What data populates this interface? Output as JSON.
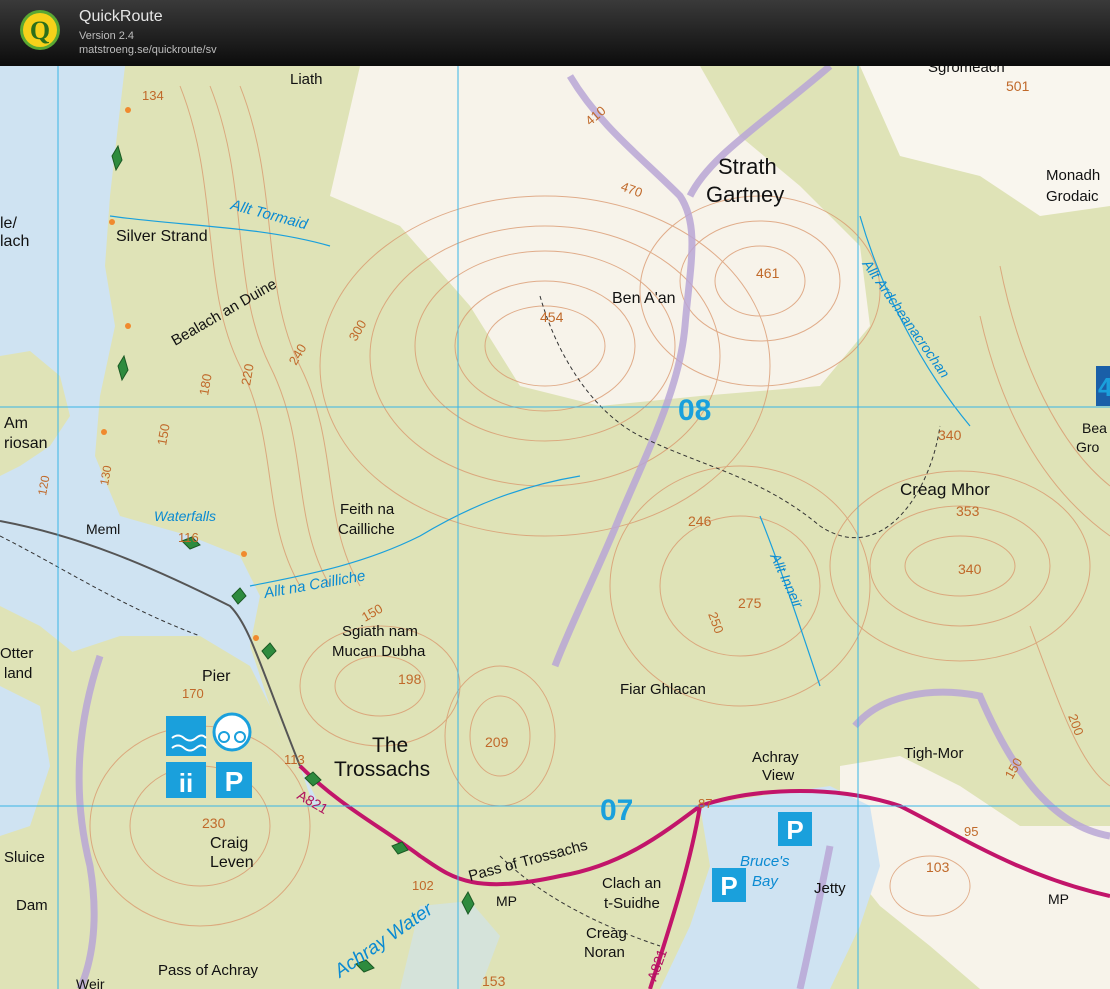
{
  "app": {
    "title": "QuickRoute",
    "version": "Version 2.4",
    "url": "matstroeng.se/quickroute/sv",
    "logo_letter": "Q"
  },
  "map": {
    "place_names": {
      "liath": "Liath",
      "sgromeach": "Sgromeach",
      "strath": "Strath",
      "gartney": "Gartney",
      "monadh": "Monadh",
      "grodaic": "Grodaic",
      "silver_strand": "Silver Strand",
      "bealach_an_duine": "Bealach an Duine",
      "ben_a_an": "Ben A'an",
      "am": "Am",
      "riosan": "riosan",
      "le_slash": "le/",
      "lach": "lach",
      "meml": "Meml",
      "feith_na": "Feith na",
      "cailliche": "Cailliche",
      "creag_mhor": "Creag Mhor",
      "sgiath_nam": "Sgiath nam",
      "mucan_dubha": "Mucan Dubha",
      "fiar_ghlacan": "Fiar Ghlacan",
      "otter": "Otter",
      "land": "land",
      "pier": "Pier",
      "the": "The",
      "trossachs": "Trossachs",
      "achray": "Achray",
      "view": "View",
      "tigh_mor": "Tigh-Mor",
      "craig": "Craig",
      "leven": "Leven",
      "pass_of_trossachs": "Pass of Trossachs",
      "clach_an": "Clach an",
      "t_suidhe": "t-Suidhe",
      "creag": "Creag",
      "noran": "Noran",
      "jetty": "Jetty",
      "sluice": "Sluice",
      "dam": "Dam",
      "pass_of_achray": "Pass of Achray",
      "mp1": "MP",
      "mp2": "MP",
      "bea": "Bea",
      "gro": "Gro",
      "weir": "Weir"
    },
    "water_names": {
      "allt_tormaid": "Allt Tormaid",
      "waterfalls": "Waterfalls",
      "allt_na_cailliche": "Allt na Cailliche",
      "allt_ardcheanacrochan": "Allt Ardcheanacrochan",
      "allt_inneir": "Allt Inneir",
      "achray_water": "Achray Water",
      "bruces": "Bruce's",
      "bay": "Bay"
    },
    "heights": {
      "h134": "134",
      "h501": "501",
      "h470": "470",
      "h410": "410",
      "h461": "461",
      "h454": "454",
      "h300": "300",
      "h240": "240",
      "h220": "220",
      "h180": "180",
      "h150a": "150",
      "h130": "130",
      "h120": "120",
      "h116": "116",
      "h340a": "340",
      "h353": "353",
      "h340b": "340",
      "h246": "246",
      "h275": "275",
      "h250": "250",
      "h150b": "150",
      "h198": "198",
      "h209": "209",
      "h170": "170",
      "h230": "230",
      "h113": "113",
      "h87": "87",
      "h95": "95",
      "h103": "103",
      "h102": "102",
      "h153": "153",
      "h200": "200",
      "h150c": "150"
    },
    "grid_numbers": {
      "g08": "08",
      "g07": "07",
      "g4": "4"
    },
    "road_labels": {
      "a821_west": "A821",
      "a821_south": "A821"
    },
    "symbols": {
      "parking_1": "P",
      "parking_2": "P",
      "parking_3": "P",
      "toilets": "ii"
    },
    "colors": {
      "land": "#dfe3b7",
      "open_ground": "#f7f3ea",
      "water": "#cfe3f2",
      "contour": "#d9956a",
      "grid": "#3ab4e6",
      "road": "#c2156a",
      "boundary": "#b9a6d6",
      "route": "#2e8b3e"
    }
  }
}
